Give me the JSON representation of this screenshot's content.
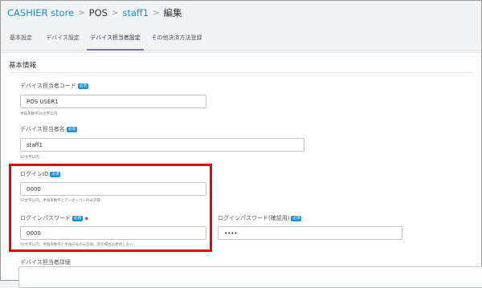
{
  "breadcrumb": {
    "store": "CASHIER store",
    "pos": "POS",
    "staff": "staff1",
    "current": "編集",
    "separator": ">"
  },
  "tabs": [
    {
      "label": "基本設定",
      "active": false
    },
    {
      "label": "デバイス設定",
      "active": false
    },
    {
      "label": "デバイス担当者設定",
      "active": true
    },
    {
      "label": "その他決済方法登録",
      "active": false
    }
  ],
  "section": {
    "title": "基本情報"
  },
  "required_badge": "必須",
  "fields": {
    "staff_code": {
      "label": "デバイス担当者コード",
      "value": "POS USER1",
      "hint": "半角英数字20文字以内"
    },
    "staff_name": {
      "label": "デバイス担当者名",
      "value": "staff1",
      "hint": "40文字以内"
    },
    "login_id": {
      "label": "ログインID",
      "value": "0000",
      "hint": "50文字以内。半角英数字とアンダーバーのみ許容"
    },
    "login_password": {
      "label": "ログインパスワード",
      "value": "0000",
      "hint": "50文字以内。半角英数字と半角記号のみ許容。空の場合は更新しない"
    },
    "login_password_confirm": {
      "label": "ログインパスワード(確認用)",
      "value": "••••"
    },
    "staff_detail": {
      "label": "デバイス担当者詳細"
    }
  },
  "colors": {
    "accent": "#1d8fd4",
    "highlight": "#e8000b",
    "active_tab": "#7b6bd1"
  },
  "icons": {
    "password_toggle": "eye-icon"
  }
}
